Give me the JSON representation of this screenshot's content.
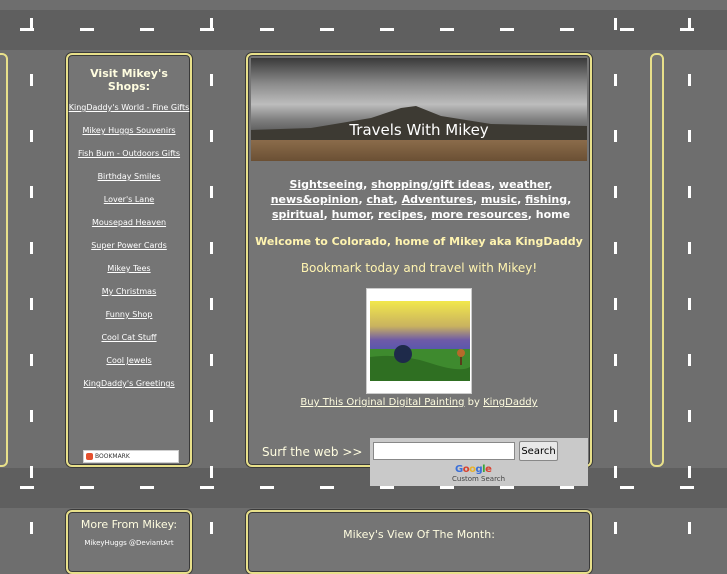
{
  "sidebar": {
    "title": "Visit Mikey's Shops:",
    "links": [
      "KingDaddy's World - Fine Gifts",
      "Mikey Huggs Souvenirs",
      "Fish Bum - Outdoors Gifts",
      "Birthday Smiles",
      "Lover's Lane",
      "Mousepad Heaven",
      "Super Power Cards",
      "Mikey Tees",
      "My Christmas",
      "Funny Shop",
      "Cool Cat Stuff",
      "Cool Jewels",
      "KingDaddy's Greetings"
    ],
    "bookmark_label": "BOOKMARK"
  },
  "main": {
    "banner_title": "Travels With Mikey",
    "nav": [
      "Sightseeing",
      "shopping/gift ideas",
      "weather",
      "news&opinion",
      "chat",
      "Adventures",
      "music",
      "fishing",
      "spiritual",
      "humor",
      "recipes",
      "more resources"
    ],
    "nav_home": "home",
    "welcome": "Welcome to Colorado, home of Mikey aka KingDaddy",
    "bookmark_today": "Bookmark today and travel with Mikey!",
    "buy_link": "Buy This Original Digital Painting",
    "buy_by": "by",
    "buy_artist": "KingDaddy",
    "surf_label": "Surf the web >>",
    "search_button": "Search",
    "google_logo": "Google",
    "custom_search": "Custom Search"
  },
  "lower": {
    "sidebar_title": "More From Mikey:",
    "sidebar_tiny": "MikeyHuggs @DeviantArt",
    "main_title": "Mikey's View Of The Month:"
  },
  "colors": {
    "background": "#6e6e6e",
    "panel_border": "#e8e08a",
    "panel_bg": "#757575",
    "accent_text": "#fff4b0"
  }
}
